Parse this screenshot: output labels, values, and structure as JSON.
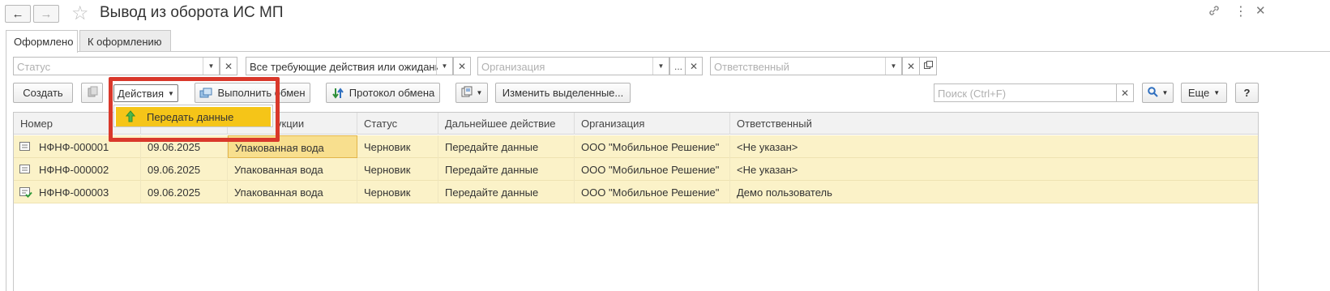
{
  "window": {
    "title": "Вывод из оборота ИС МП"
  },
  "tabs": [
    {
      "label": "Оформлено"
    },
    {
      "label": "К оформлению"
    }
  ],
  "filters": {
    "status": {
      "placeholder": "Статус"
    },
    "action": {
      "value": "Все требующие действия или ожидания"
    },
    "organization": {
      "placeholder": "Организация"
    },
    "responsible": {
      "placeholder": "Ответственный"
    }
  },
  "toolbar": {
    "create": "Создать",
    "actions": "Действия",
    "exchange": "Выполнить обмен",
    "protocol": "Протокол обмена",
    "change_selected": "Изменить выделенные...",
    "search_placeholder": "Поиск (Ctrl+F)",
    "more": "Еще",
    "help": "?"
  },
  "actions_menu": {
    "items": [
      {
        "label": "Передать данные",
        "icon": "arrow-up-green-icon"
      }
    ]
  },
  "table": {
    "columns": [
      "Номер",
      "",
      "",
      "Статус",
      "Дальнейшее действие",
      "Организация",
      "Ответственный"
    ],
    "column3_visible_suffix": "укции",
    "rows": [
      {
        "number": "НФНФ-000001",
        "date": "09.06.2025",
        "product": "Упакованная вода",
        "status": "Черновик",
        "next_action": "Передайте данные",
        "organization": "ООО \"Мобильное Решение\"",
        "responsible": "<Не указан>"
      },
      {
        "number": "НФНФ-000002",
        "date": "09.06.2025",
        "product": "Упакованная вода",
        "status": "Черновик",
        "next_action": "Передайте данные",
        "organization": "ООО \"Мобильное Решение\"",
        "responsible": "<Не указан>"
      },
      {
        "number": "НФНФ-000003",
        "date": "09.06.2025",
        "product": "Упакованная вода",
        "status": "Черновик",
        "next_action": "Передайте данные",
        "organization": "ООО \"Мобильное Решение\"",
        "responsible": "Демо пользователь"
      }
    ]
  },
  "colors": {
    "row_bg": "#fbf2c8",
    "menu_highlight": "#f5c518",
    "annotation_red": "#d9382b"
  }
}
